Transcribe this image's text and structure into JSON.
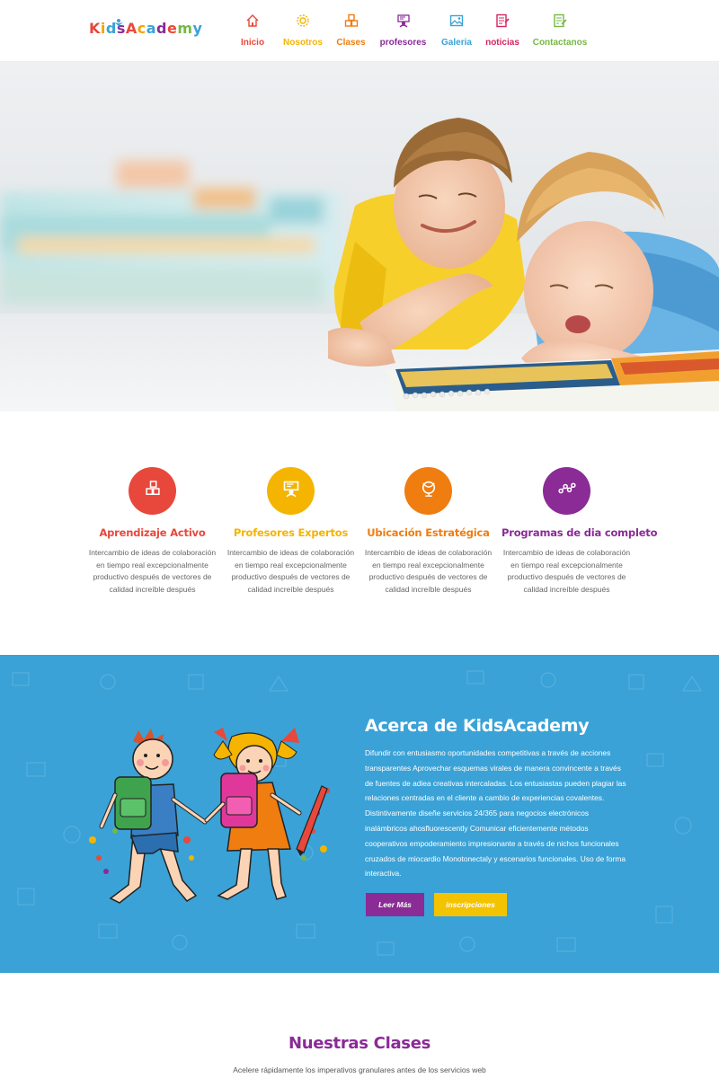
{
  "brand": {
    "logo_letters": [
      "K",
      "i",
      "d",
      "s",
      "A",
      "c",
      "a",
      "d",
      "e",
      "m",
      "y"
    ],
    "logo_colors": [
      "#e8483b",
      "#f4a300",
      "#3aa2d6",
      "#8a2b96",
      "#e8483b",
      "#f4a300",
      "#3aa2d6",
      "#8a2b96",
      "#e8483b",
      "#75b843",
      "#3aa2d6"
    ]
  },
  "nav": {
    "items": [
      {
        "label": "Inicio",
        "icon": "home-icon",
        "color": "#e8483b"
      },
      {
        "label": "Nosotros",
        "icon": "gear-icon",
        "color": "#f4b400"
      },
      {
        "label": "Clases",
        "icon": "blocks-icon",
        "color": "#f07d10"
      },
      {
        "label": "profesores",
        "icon": "teacher-icon",
        "color": "#8a2b96"
      },
      {
        "label": "Galeria",
        "icon": "picture-icon",
        "color": "#3aa2d6"
      },
      {
        "label": "noticias",
        "icon": "news-icon",
        "color": "#d6245f"
      },
      {
        "label": "Contactanos",
        "icon": "contact-icon",
        "color": "#75b843"
      }
    ]
  },
  "features": [
    {
      "title": "Aprendizaje Activo",
      "text": "Intercambio de ideas de colaboración en tiempo real excepcionalmente productivo después de vectores de calidad increíble después",
      "color": "#e8483b",
      "icon": "abc-blocks-icon"
    },
    {
      "title": "Profesores Expertos",
      "text": "Intercambio de ideas de colaboración en tiempo real excepcionalmente productivo después de vectores de calidad increíble después",
      "color": "#f4b400",
      "icon": "teacher-icon"
    },
    {
      "title": "Ubicación Estratégica",
      "text": "Intercambio de ideas de colaboración en tiempo real excepcionalmente productivo después de vectores de calidad increíble después",
      "color": "#f07d10",
      "icon": "globe-icon"
    },
    {
      "title": "Programas de dia completo",
      "text": "Intercambio de ideas de colaboración en tiempo real excepcionalmente productivo después de vectores de calidad increíble después",
      "color": "#8a2b96",
      "icon": "route-icon"
    }
  ],
  "about": {
    "title": "Acerca de KidsAcademy",
    "text": "Difundir con entusiasmo oportunidades competitivas a través de acciones transparentes Aprovechar esquemas virales de manera convincente a través de fuentes de adiea creativas intercaladas. Los entusiastas pueden plagiar las relaciones centradas en el cliente a cambio de experiencias covalentes. Distintivamente diseñe servicios 24/365 para negocios electrónicos inalámbricos ahosfluorescently Comunicar eficientemente métodos cooperativos empoderamiento impresionante a través de nichos funcionales cruzados de miocardio Monotonectaly y escenarios funcionales. Uso de forma interactiva.",
    "read_more": "Leer Más",
    "enroll": "inscripciones",
    "background": "#3aa2d6",
    "read_more_color": "#8a2b96",
    "enroll_color": "#f4c300"
  },
  "classes": {
    "title": "Nuestras Clases",
    "subtitle": "Acelere rápidamente los imperativos granulares antes de los servicios web"
  }
}
